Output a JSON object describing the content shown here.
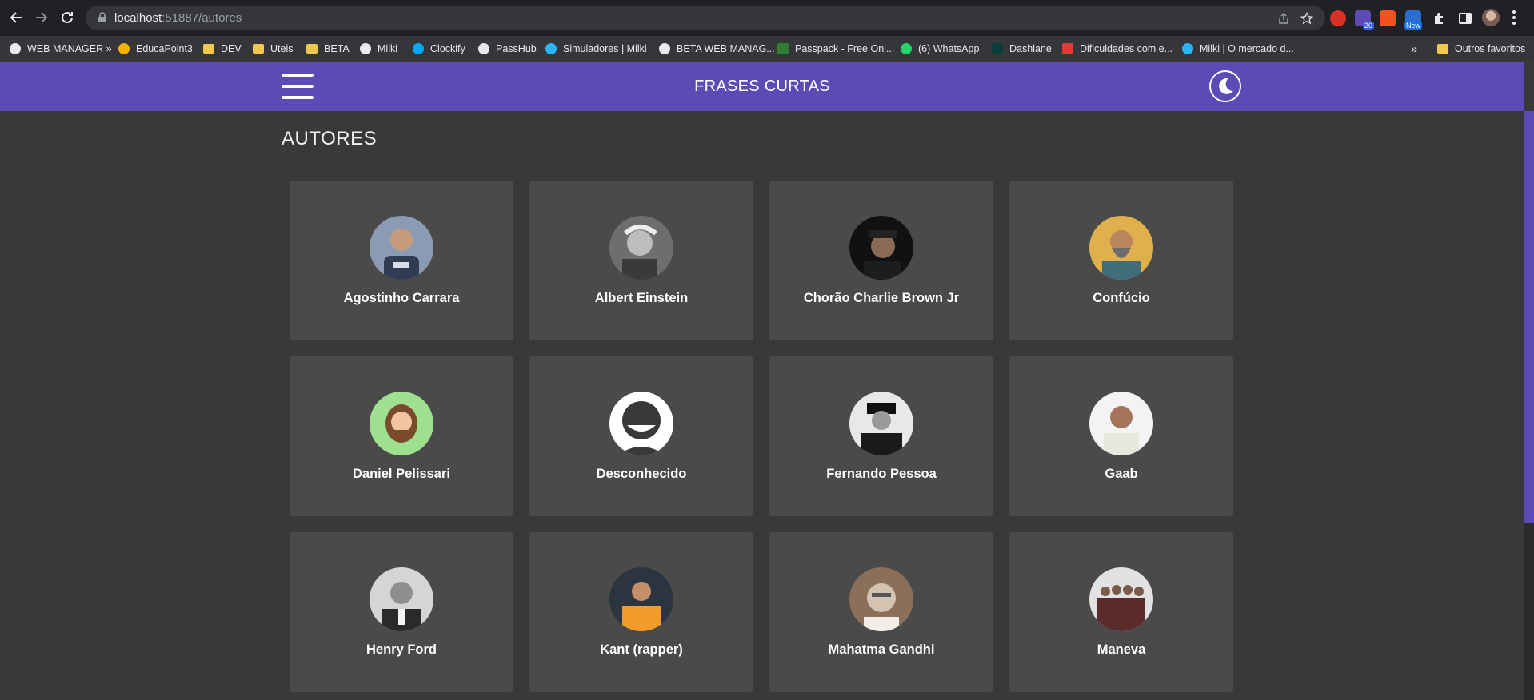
{
  "browser": {
    "url_host": "localhost",
    "url_rest": ":51887/autores",
    "bookmarks": [
      {
        "label": "WEB MANAGER »"
      },
      {
        "label": "EducaPoint3"
      },
      {
        "label": "DEV"
      },
      {
        "label": "Uteis"
      },
      {
        "label": "BETA"
      },
      {
        "label": "Milki"
      },
      {
        "label": "Clockify"
      },
      {
        "label": "PassHub"
      },
      {
        "label": "Simuladores | Milki"
      },
      {
        "label": "BETA WEB MANAG..."
      },
      {
        "label": "Passpack - Free Onl..."
      },
      {
        "label": "(6) WhatsApp"
      },
      {
        "label": "Dashlane"
      },
      {
        "label": "Dificuldades com e..."
      },
      {
        "label": "Milki | O mercado d..."
      }
    ],
    "overflow_label": "»",
    "other_bookmarks": "Outros favoritos",
    "extension_badge": "20",
    "extension_new": "New"
  },
  "header": {
    "title": "FRASES CURTAS"
  },
  "page": {
    "section_title": "AUTORES"
  },
  "authors": [
    {
      "name": "Agostinho Carrara"
    },
    {
      "name": "Albert Einstein"
    },
    {
      "name": "Chorão Charlie Brown Jr"
    },
    {
      "name": "Confúcio"
    },
    {
      "name": "Daniel Pelissari"
    },
    {
      "name": "Desconhecido"
    },
    {
      "name": "Fernando Pessoa"
    },
    {
      "name": "Gaab"
    },
    {
      "name": "Henry Ford"
    },
    {
      "name": "Kant (rapper)"
    },
    {
      "name": "Mahatma Gandhi"
    },
    {
      "name": "Maneva"
    }
  ],
  "colors": {
    "header_bg": "#5b4bb5",
    "page_bg": "#3a3838",
    "card_bg": "#4a4a4a"
  }
}
